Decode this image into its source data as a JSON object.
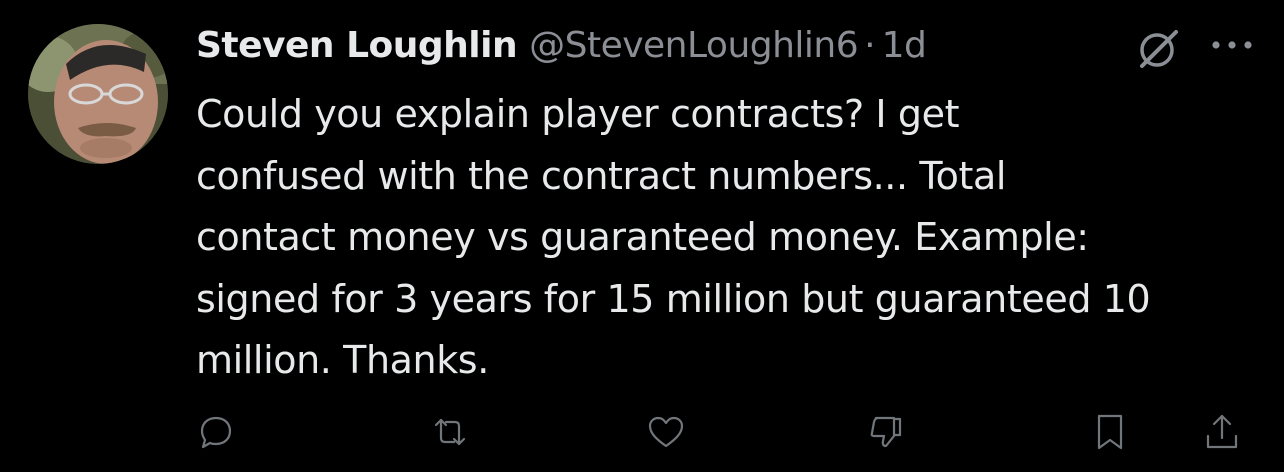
{
  "tweet": {
    "author": {
      "display_name": "Steven Loughlin",
      "handle": "@StevenLoughlin6",
      "avatar_icon": "profile-photo"
    },
    "separator": "·",
    "time": "1d",
    "text": "Could you explain player contracts? I get\nconfused with the contract numbers... Total\ncontact money vs guaranteed money. Example:\nsigned for 3 years for 15 million but guaranteed 10\nmillion. Thanks.",
    "header_icons": [
      "grok-icon",
      "more-icon"
    ],
    "actions": [
      "reply-icon",
      "retweet-icon",
      "like-icon",
      "dislike-icon",
      "bookmark-icon",
      "share-icon"
    ]
  },
  "colors": {
    "background": "#000000",
    "primary_text": "#e7e9ea",
    "secondary_text": "#8b8f95",
    "icon": "#71767b"
  }
}
